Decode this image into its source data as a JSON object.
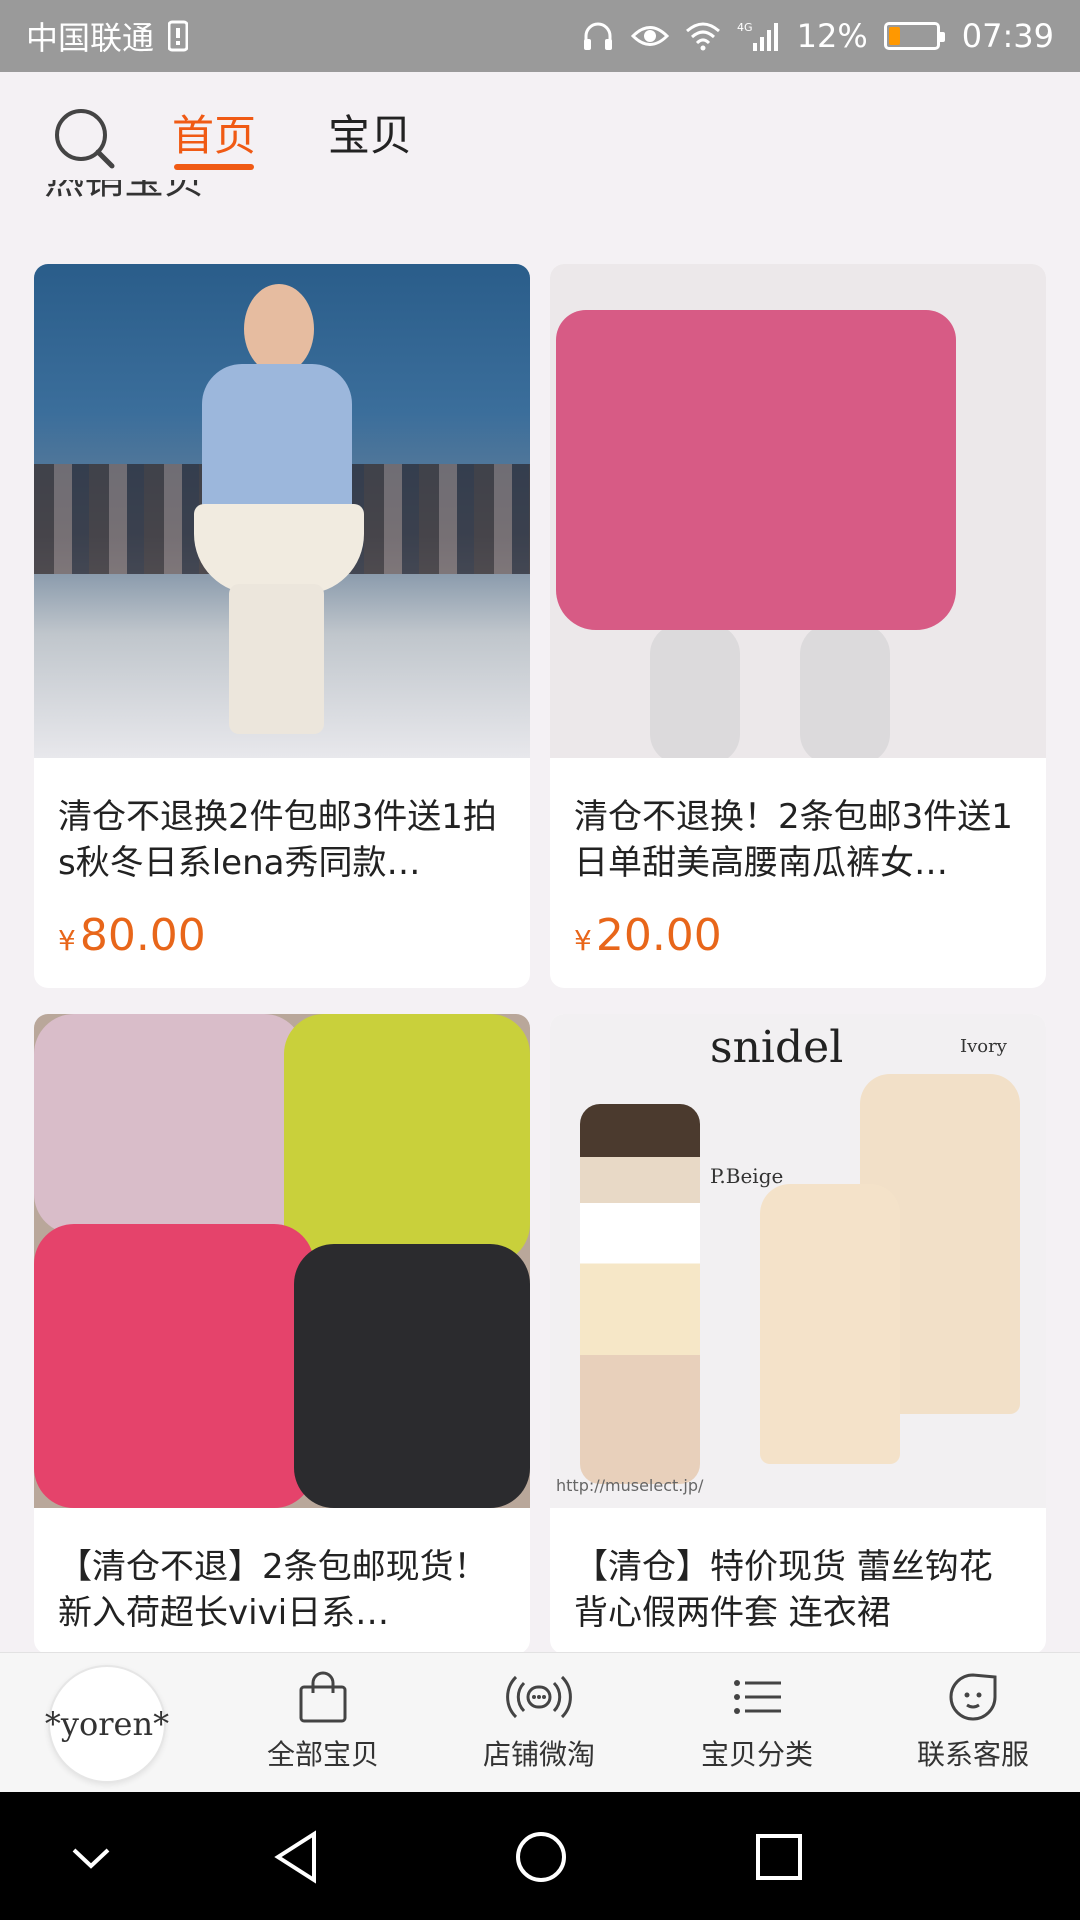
{
  "status_bar": {
    "carrier": "中国联通",
    "signal_type": "4G",
    "battery_percent": "12%",
    "battery_level": 0.12,
    "time": "07:39"
  },
  "header": {
    "tabs": [
      {
        "label": "首页",
        "active": true
      },
      {
        "label": "宝贝",
        "active": false
      }
    ],
    "section_title": "热销宝贝"
  },
  "products": [
    {
      "title": "清仓不退换2件包邮3件送1拍s秋冬日系lena秀同款…",
      "currency": "¥",
      "price": "80.00"
    },
    {
      "title": "清仓不退换！2条包邮3件送1日单甜美高腰南瓜裤女…",
      "currency": "¥",
      "price": "20.00"
    },
    {
      "title": "【清仓不退】2条包邮现货！新入荷超长vivi日系…",
      "currency": "¥",
      "price": ""
    },
    {
      "title": "【清仓】特价现货 蕾丝钩花背心假两件套 连衣裙",
      "currency": "¥",
      "price": ""
    }
  ],
  "product_image_text": {
    "brand": "snidel",
    "ivory": "Ivory",
    "pbeige": "P.Beige",
    "url": "http://muselect.jp/"
  },
  "bottom_nav": {
    "shop_logo": "*yoren*",
    "items": [
      {
        "label": "全部宝贝",
        "icon": "shopping-bag-icon"
      },
      {
        "label": "店铺微淘",
        "icon": "broadcast-icon"
      },
      {
        "label": "宝贝分类",
        "icon": "list-icon"
      },
      {
        "label": "联系客服",
        "icon": "chat-face-icon"
      }
    ]
  },
  "colors": {
    "accent": "#f05a14",
    "price": "#e8661a",
    "status_bar": "#9a9a9a",
    "background": "#f4f1f4"
  }
}
